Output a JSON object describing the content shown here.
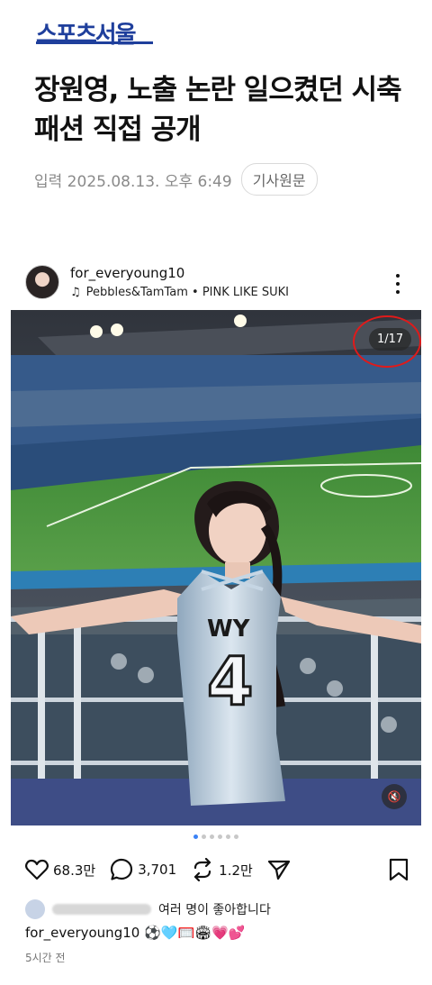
{
  "header": {
    "logo": "스포츠서울"
  },
  "article": {
    "headline": "장원영, 노출 논란 일으켰던 시축 패션 직접 공개",
    "date": "입력 2025.08.13. 오후 6:49",
    "original_button": "기사원문"
  },
  "post": {
    "username": "for_everyoung10",
    "music": "Pebbles&TamTam • PINK LIKE SUKI",
    "counter": "1/17",
    "jersey_text": "WY 4",
    "likes": "68.3만",
    "comments": "3,701",
    "reposts": "1.2만",
    "liked_by_suffix": "여러 명이 좋아합니다",
    "caption_user": "for_everyoung10",
    "caption_emoji": "⚽🩵🥅🏟💗💕",
    "time_ago": "5시간 전",
    "page_dots": 6,
    "active_dot": 0
  },
  "colors": {
    "brand": "#1f3f9c",
    "highlight_circle": "#e01a1a",
    "active_dot": "#3b82f6"
  },
  "icons": [
    "heart-icon",
    "comment-icon",
    "repost-icon",
    "share-icon",
    "bookmark-icon",
    "music-note-icon",
    "more-icon",
    "mute-icon"
  ]
}
